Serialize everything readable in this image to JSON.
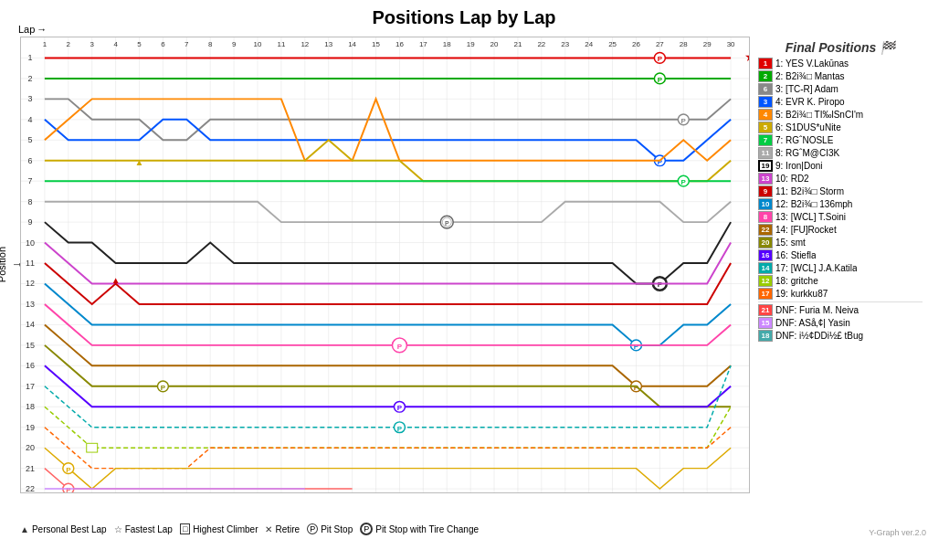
{
  "title": "Positions Lap by Lap",
  "lap_label": "Lap",
  "position_label": "Position",
  "version": "Y-Graph ver.2.0",
  "laps": [
    "1",
    "2",
    "3",
    "4",
    "5",
    "6",
    "7",
    "8",
    "9",
    "10",
    "11",
    "12",
    "13",
    "14",
    "15",
    "16",
    "17",
    "18",
    "19",
    "20",
    "21",
    "22",
    "23",
    "24",
    "25",
    "26",
    "27",
    "28",
    "29",
    "30"
  ],
  "positions": [
    "1",
    "2",
    "3",
    "4",
    "5",
    "6",
    "7",
    "8",
    "9",
    "10",
    "11",
    "12",
    "13",
    "14",
    "15",
    "16",
    "17",
    "18",
    "19",
    "20",
    "21",
    "22"
  ],
  "final_positions_title": "Final Positions",
  "final_positions": [
    {
      "pos": "1",
      "color": "#e00000",
      "text": "1: YES V.Lakūnas"
    },
    {
      "pos": "2",
      "color": "#00aa00",
      "text": "2: B2i¾□ Mantas"
    },
    {
      "pos": "6",
      "color": "#888888",
      "text": "3: [TC-R] Adam"
    },
    {
      "pos": "3",
      "color": "#0055ff",
      "text": "4: EVR K. Piropo"
    },
    {
      "pos": "4",
      "color": "#ff8800",
      "text": "5: B2i¾□ TI‰lSnCI'm"
    },
    {
      "pos": "5",
      "color": "#ffcc00",
      "text": "6: S1DUS*uNite"
    },
    {
      "pos": "7",
      "color": "#00cc44",
      "text": "7: RG&circ;NOSLE"
    },
    {
      "pos": "11",
      "color": "#aaaaaa",
      "text": "8: RG&circ;M@CI3K"
    },
    {
      "pos": "19",
      "color": "#000000",
      "border": "2px solid black",
      "text": "9: Iron|Doni"
    },
    {
      "pos": "13",
      "color": "#cc44cc",
      "text": "10: RD2"
    },
    {
      "pos": "9",
      "color": "#cc0000",
      "text": "11: B2i¾□ Storm"
    },
    {
      "pos": "10",
      "color": "#0088cc",
      "text": "12: B2i¾□ 136mph"
    },
    {
      "pos": "8",
      "color": "#ff44aa",
      "text": "13: [WCL] T.Soini"
    },
    {
      "pos": "22",
      "color": "#aa6600",
      "text": "14: [FU]Rocket"
    },
    {
      "pos": "20",
      "color": "#888800",
      "text": "15: smt"
    },
    {
      "pos": "16",
      "color": "#5500ff",
      "text": "16: Stiefla"
    },
    {
      "pos": "14",
      "color": "#00aaaa",
      "text": "17: [WCL] J.A.Katila"
    },
    {
      "pos": "12",
      "color": "#99cc00",
      "text": "18: gritche"
    },
    {
      "pos": "17",
      "color": "#ff6600",
      "text": "19: kurkku87"
    },
    {
      "pos": "21",
      "color": "#ff4444",
      "text": "DNF: Furia M. Neiva"
    },
    {
      "pos": "15",
      "color": "#cc88ff",
      "text": "DNF: ASå‚¢| Yasin"
    },
    {
      "pos": "18",
      "color": "#44aaaa",
      "text": "DNF: i½¢DDi½£ tBug"
    }
  ],
  "bottom_legend": [
    {
      "symbol": "▲",
      "text": "Personal Best Lap"
    },
    {
      "symbol": "☆",
      "text": "Fastest Lap"
    },
    {
      "symbol": "□",
      "text": "Highest Climber"
    },
    {
      "symbol": "✕",
      "text": "Retire"
    },
    {
      "symbol": "P",
      "text": "Pit Stop"
    },
    {
      "symbol": "Ⓟ",
      "text": "Pit Stop with Tire Change"
    }
  ]
}
